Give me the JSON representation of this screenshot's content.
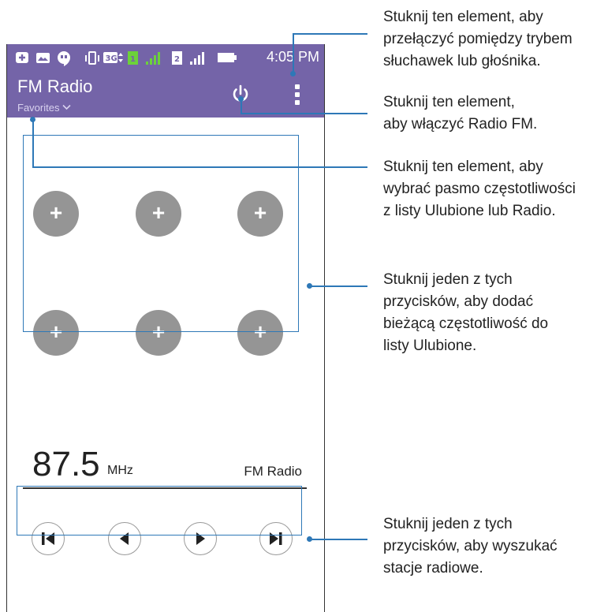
{
  "status_bar": {
    "time": "4:05 PM",
    "icons": [
      "plus-box-icon",
      "image-icon",
      "hangouts-icon",
      "vibrate-icon",
      "3g-icon",
      "sim1-icon",
      "signal-icon",
      "sim2-icon",
      "signal-icon",
      "battery-icon"
    ]
  },
  "app_bar": {
    "title": "FM Radio",
    "subtitle": "Favorites",
    "subtitle_chevron": "chevron-down-icon",
    "power_icon": "power-icon",
    "menu_icon": "overflow-menu-icon",
    "color": "#7464a8"
  },
  "presets": {
    "symbol": "+",
    "count": 6,
    "color": "#959595"
  },
  "frequency": {
    "value": "87.5",
    "unit": "MHz",
    "label": "FM Radio"
  },
  "controls": [
    "skip-previous-icon",
    "seek-back-icon",
    "seek-forward-icon",
    "skip-next-icon"
  ],
  "callouts": {
    "menu": [
      "Stuknij ten element, aby",
      "przełączyć pomiędzy trybem",
      "słuchawek lub głośnika."
    ],
    "power": [
      "Stuknij ten element,",
      "aby włączyć Radio FM."
    ],
    "favorites": [
      "Stuknij ten element, aby",
      "wybrać pasmo częstotliwości",
      "z listy Ulubione lub Radio."
    ],
    "presets": [
      "Stuknij jeden z tych",
      "przycisków, aby dodać",
      "bieżącą częstotliwość do",
      "listy Ulubione."
    ],
    "controls": [
      "Stuknij jeden z tych",
      "przycisków, aby wyszukać",
      "stacje radiowe."
    ]
  },
  "accent_color": "#2e78b7"
}
